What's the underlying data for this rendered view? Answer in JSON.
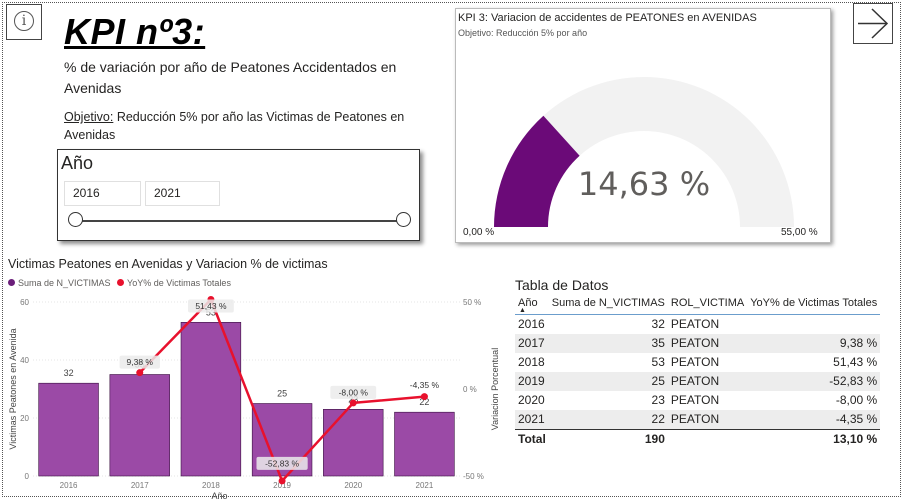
{
  "header": {
    "info_icon": "info-icon",
    "next_icon": "arrow-right-icon",
    "title": "KPI nº3:",
    "description": "% de variación por año de Peatones Accidentados en Avenidas",
    "objective_label": "Objetivo:",
    "objective_text": " Reducción 5% por año las Victimas de Peatones en Avenidas"
  },
  "slicer": {
    "title": "Año",
    "from": "2016",
    "to": "2021",
    "range": [
      2016,
      2021
    ]
  },
  "gauge": {
    "title": "KPI 3: Variacion de accidentes de PEATONES en AVENIDAS",
    "subtitle": "Objetivo: Reducción 5% por año",
    "value_label": "14,63 %",
    "value": 14.63,
    "min_label": "0,00 %",
    "max_label": "55,00 %",
    "min": 0,
    "max": 55,
    "fill_color": "#6b0a78",
    "track_color": "#f2f2f2"
  },
  "chart": {
    "title": "Victimas Peatones en Avenidas y Variacion % de victimas",
    "legend": [
      {
        "label": "Suma de N_VICTIMAS",
        "color": "#6b1f7a"
      },
      {
        "label": "YoY% de Victimas Totales",
        "color": "#e8112d"
      }
    ]
  },
  "chart_data": {
    "type": "bar",
    "title": "Victimas Peatones en Avenidas y Variacion % de victimas",
    "categories": [
      "2016",
      "2017",
      "2018",
      "2019",
      "2020",
      "2021"
    ],
    "xlabel": "Año",
    "ylabel": "Victimas Peatones en Avenida",
    "y2label": "Variacion Porcentual",
    "ylim": [
      0,
      60
    ],
    "y_ticks": [
      0,
      20,
      40,
      60
    ],
    "y2lim": [
      -50,
      50
    ],
    "y2_ticks": [
      "-50 %",
      "0 %",
      "50 %"
    ],
    "series": [
      {
        "name": "Suma de N_VICTIMAS",
        "type": "bar",
        "axis": "left",
        "color": "#9b4aa6",
        "values": [
          32,
          35,
          53,
          25,
          23,
          22
        ],
        "labels": [
          "32",
          "35",
          "53",
          "25",
          "23",
          "22"
        ]
      },
      {
        "name": "YoY% de Victimas Totales",
        "type": "line",
        "axis": "right",
        "color": "#e8112d",
        "values": [
          null,
          9.38,
          51.43,
          -52.83,
          -8.0,
          -4.35
        ],
        "labels": [
          "",
          "9,38 %",
          "51,43 %",
          "-52,83 %",
          "-8,00 %",
          "-4,35 %"
        ]
      }
    ],
    "grid": true,
    "legend_position": "top-left"
  },
  "table": {
    "title": "Tabla de Datos",
    "columns": [
      "Año",
      "Suma de N_VICTIMAS",
      "ROL_VICTIMA",
      "YoY% de Victimas Totales"
    ],
    "rows": [
      [
        "2016",
        "32",
        "PEATON",
        ""
      ],
      [
        "2017",
        "35",
        "PEATON",
        "9,38 %"
      ],
      [
        "2018",
        "53",
        "PEATON",
        "51,43 %"
      ],
      [
        "2019",
        "25",
        "PEATON",
        "-52,83 %"
      ],
      [
        "2020",
        "23",
        "PEATON",
        "-8,00 %"
      ],
      [
        "2021",
        "22",
        "PEATON",
        "-4,35 %"
      ]
    ],
    "total": [
      "Total",
      "190",
      "",
      "13,10 %"
    ]
  }
}
